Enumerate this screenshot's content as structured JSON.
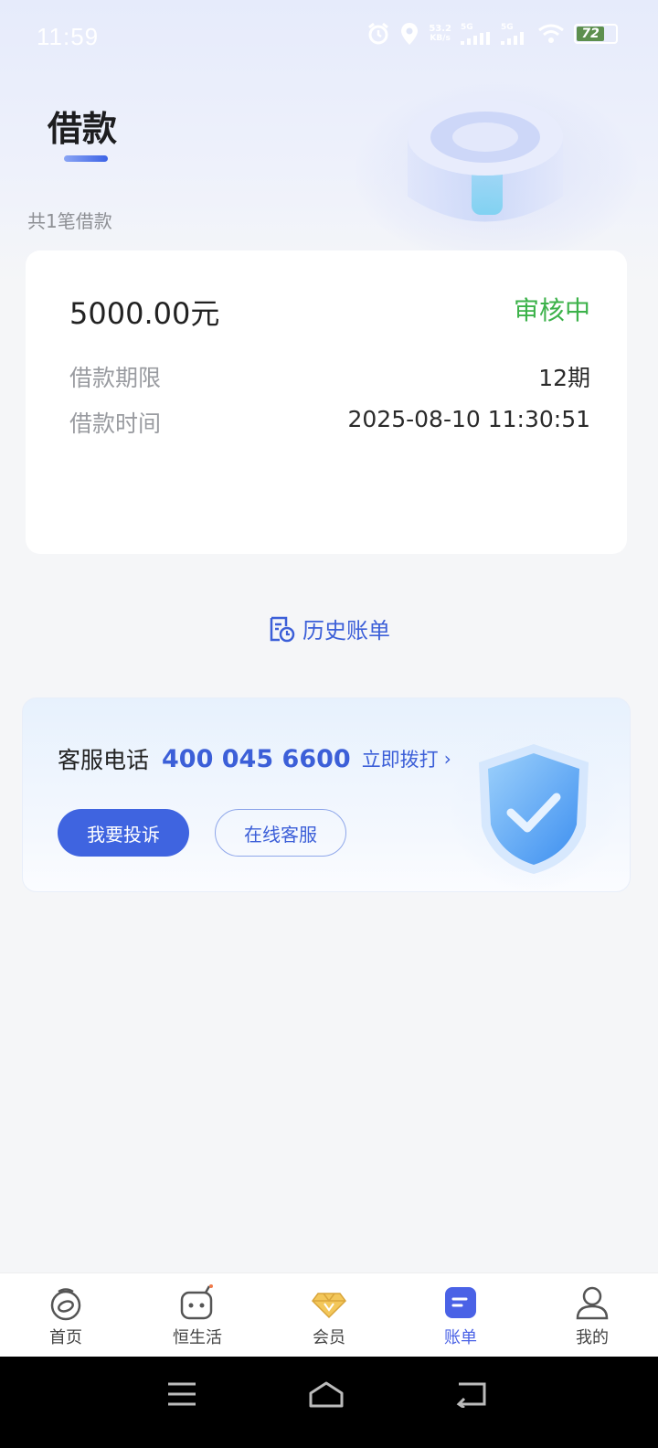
{
  "status_bar": {
    "time": "11:59",
    "speed_value": "53.2",
    "speed_unit": "KB/s",
    "sim1": "5G",
    "sim2": "5G",
    "battery": "72"
  },
  "header": {
    "title": "借款",
    "count_text": "共1笔借款"
  },
  "loan": {
    "amount": "5000.00元",
    "status": "审核中",
    "term_label": "借款期限",
    "term_value": "12期",
    "time_label": "借款时间",
    "time_value": "2025-08-10 11:30:51"
  },
  "history_link": "历史账单",
  "service": {
    "label": "客服电话",
    "phone": "400 045 6600",
    "call_label": "立即拨打",
    "complain_button": "我要投诉",
    "online_button": "在线客服"
  },
  "tabs": [
    {
      "label": "首页",
      "icon": "home-money-icon",
      "active": false
    },
    {
      "label": "恒生活",
      "icon": "robot-face-icon",
      "active": false
    },
    {
      "label": "会员",
      "icon": "diamond-icon",
      "active": false
    },
    {
      "label": "账单",
      "icon": "bill-icon",
      "active": true
    },
    {
      "label": "我的",
      "icon": "profile-icon",
      "active": false
    }
  ],
  "colors": {
    "accent": "#3f64e0",
    "status_green": "#3cb24a",
    "tab_active": "#4a62e6"
  }
}
